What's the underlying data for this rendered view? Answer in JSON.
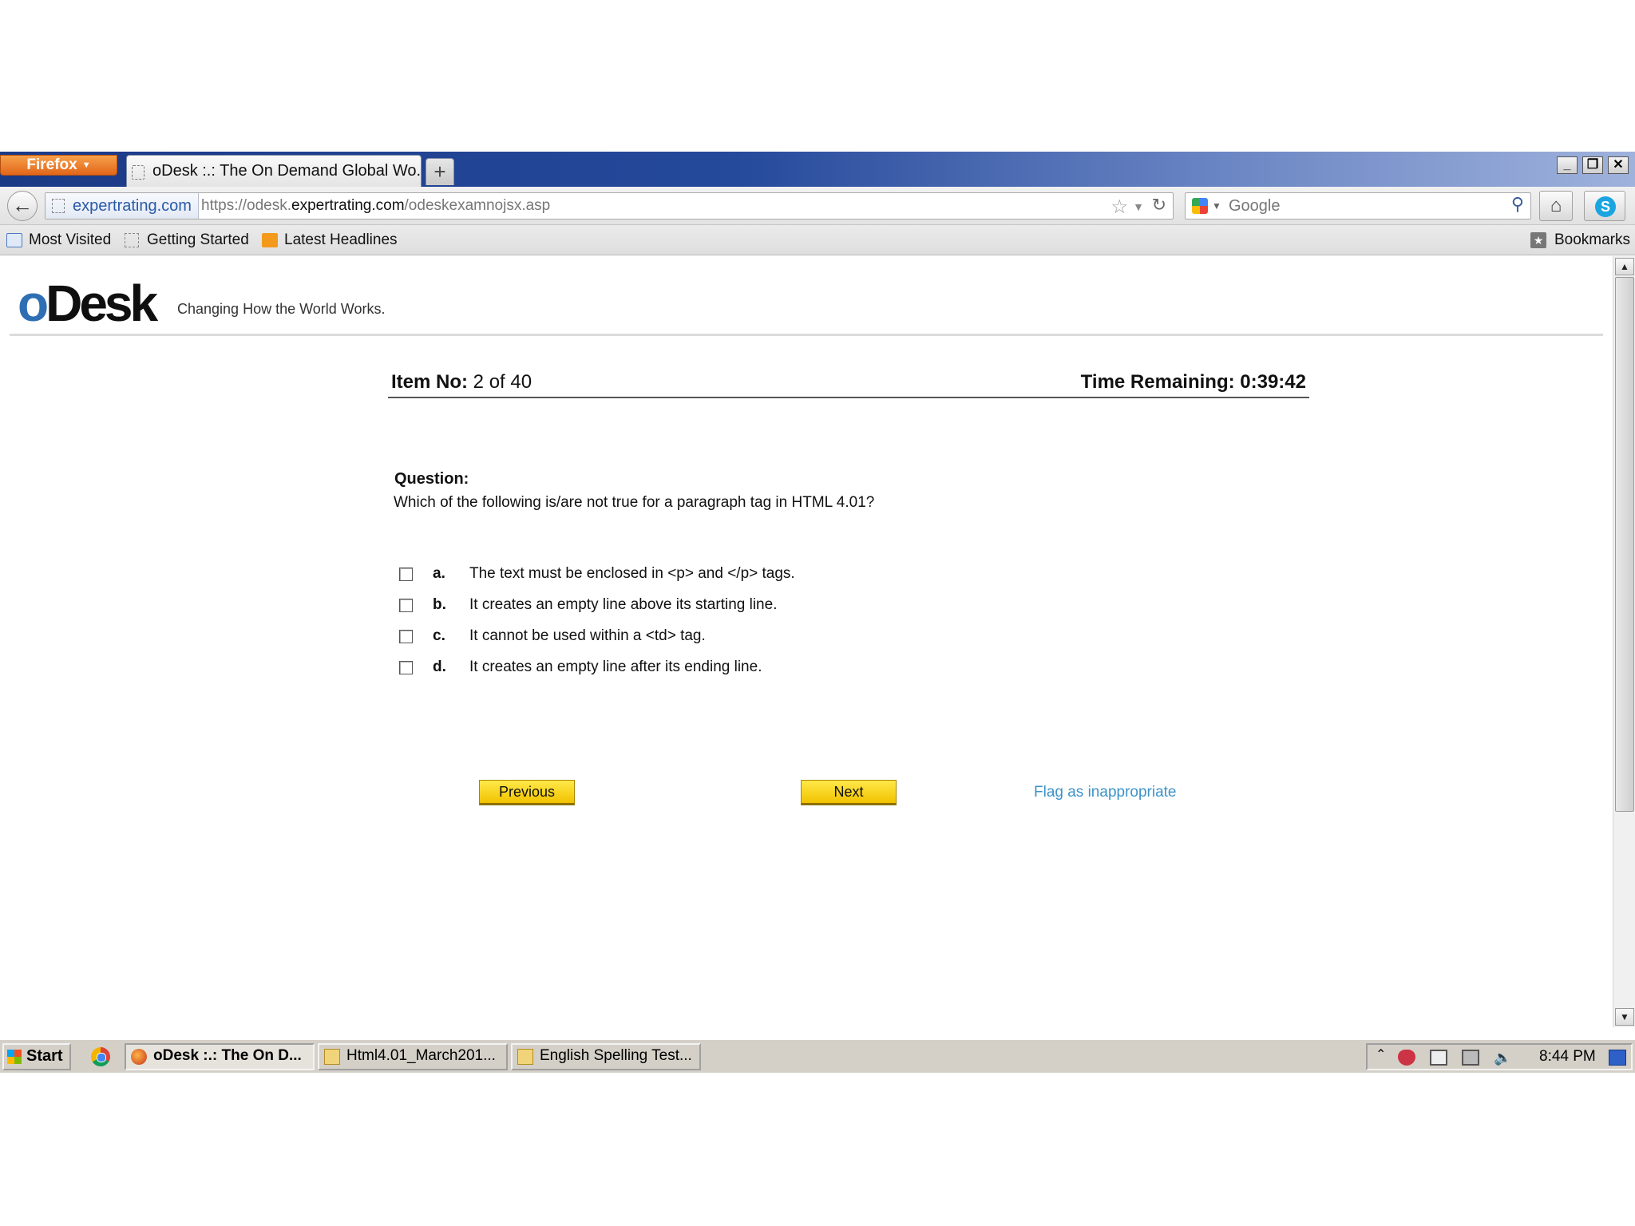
{
  "browser": {
    "menu_button": "Firefox",
    "tab_title": "oDesk :.: The On Demand Global Wo...",
    "new_tab": "+",
    "window_controls": {
      "minimize": "_",
      "restore": "❐",
      "close": "✕"
    },
    "identity": "expertrating.com",
    "url": {
      "prefix": "https://odesk.",
      "domain": "expertrating.com",
      "path": "/odeskexamnojsx.asp"
    },
    "search_placeholder": "Google",
    "icons": [
      "back-arrow-icon",
      "star-icon",
      "reload-icon",
      "google-icon",
      "magnifier-icon",
      "home-icon",
      "skype-icon"
    ]
  },
  "bookmarks": {
    "items": [
      {
        "label": "Most Visited"
      },
      {
        "label": "Getting Started"
      },
      {
        "label": "Latest Headlines"
      }
    ],
    "bookmarks_label": "Bookmarks"
  },
  "page": {
    "logo": {
      "o": "o",
      "rest": "Desk"
    },
    "tagline": "Changing How the World Works.",
    "item_no_label": "Item No:",
    "item_no_value": "2 of 40",
    "time_remaining": "Time Remaining: 0:39:42",
    "question_label": "Question:",
    "question_text": "Which of the following is/are not true for a paragraph tag in HTML 4.01?",
    "options": [
      {
        "letter": "a.",
        "text": "The text must be enclosed in <p> and </p> tags.",
        "checked": false
      },
      {
        "letter": "b.",
        "text": "It creates an empty line above its starting line.",
        "checked": false
      },
      {
        "letter": "c.",
        "text": "It cannot be used within a <td> tag.",
        "checked": false
      },
      {
        "letter": "d.",
        "text": "It creates an empty line after its ending line.",
        "checked": false
      }
    ],
    "previous_label": "Previous",
    "next_label": "Next",
    "flag_label": "Flag as inappropriate",
    "colors": {
      "button_yellow": "#f9d71c",
      "link_blue": "#3d93c8",
      "logo_blue": "#2e6fb4"
    }
  },
  "taskbar": {
    "start_label": "Start",
    "tasks": [
      {
        "label": "oDesk :.: The On D...",
        "active": true
      },
      {
        "label": "Html4.01_March201...",
        "active": false
      },
      {
        "label": "English Spelling Test...",
        "active": false
      }
    ],
    "clock": "8:44 PM",
    "tray_arrow": "⌃"
  }
}
